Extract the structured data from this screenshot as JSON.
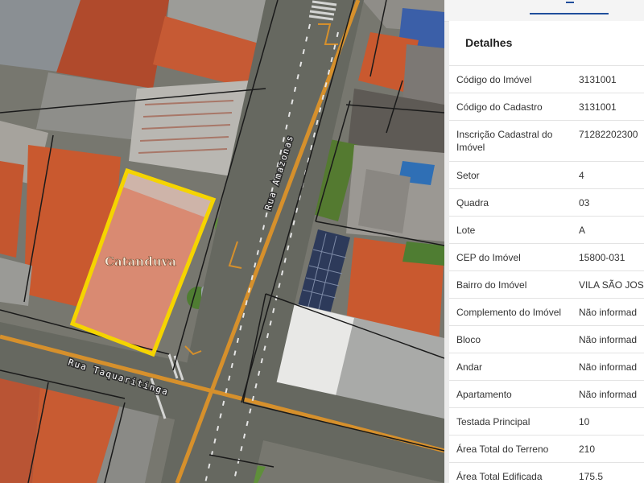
{
  "map": {
    "street_labels": {
      "amazonas": "Rua Amazonas",
      "taquaritinga": "Rua Taquaritinga"
    },
    "city_label": "Catanduva",
    "colors": {
      "selection_outline": "#f5d400",
      "road_centerline": "#d6902c",
      "parcel_lines": "#1a1a1a"
    }
  },
  "panel": {
    "title": "Detalhes",
    "rows": [
      {
        "label": "Código do Imóvel",
        "value": "3131001"
      },
      {
        "label": "Código do Cadastro",
        "value": "3131001"
      },
      {
        "label": "Inscrição Cadastral do Imóvel",
        "value": "71282202300"
      },
      {
        "label": "Setor",
        "value": "4"
      },
      {
        "label": "Quadra",
        "value": "03"
      },
      {
        "label": "Lote",
        "value": "A"
      },
      {
        "label": "CEP do Imóvel",
        "value": "15800-031"
      },
      {
        "label": "Bairro do Imóvel",
        "value": "VILA SÃO JOS"
      },
      {
        "label": "Complemento do Imóvel",
        "value": "Não informad"
      },
      {
        "label": "Bloco",
        "value": "Não informad"
      },
      {
        "label": "Andar",
        "value": "Não informad"
      },
      {
        "label": "Apartamento",
        "value": "Não informad"
      },
      {
        "label": "Testada Principal",
        "value": "10"
      },
      {
        "label": "Área Total do Terreno",
        "value": "210"
      },
      {
        "label": "Área Total Edificada",
        "value": "175.5"
      }
    ]
  }
}
